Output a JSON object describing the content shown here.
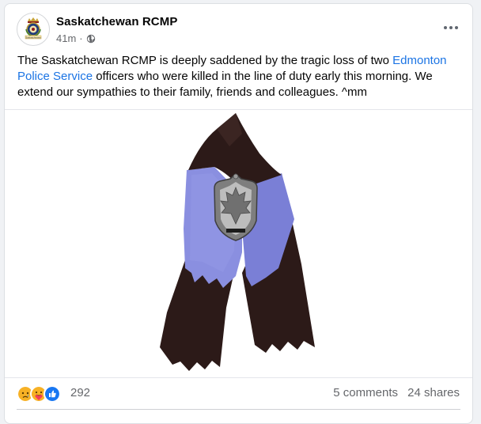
{
  "post": {
    "page_name": "Saskatchewan RCMP",
    "timestamp": "41m",
    "separator": "·",
    "audience_icon": "globe-icon",
    "avatar_caption": "Saskatchewan",
    "text_before_link": "The Saskatchewan RCMP is deeply saddened by the tragic loss of two ",
    "link_text": "Edmonton Police Service",
    "text_after_link": " officers who were killed in the line of duty early this morning. We extend our sympathies to their family, friends and colleagues. ^mm",
    "photo_subject": "mourning-ribbon-with-badge"
  },
  "stats": {
    "reactions": [
      "sad",
      "care",
      "like"
    ],
    "reaction_count": "292",
    "comments_label": "5 comments",
    "shares_label": "24 shares"
  },
  "colors": {
    "link": "#1b74e4",
    "ribbon_dark": "#2c1a18",
    "ribbon_blue": "#7a7fd6",
    "like_blue": "#1877f2",
    "sad_yellow": "#f7b125"
  }
}
